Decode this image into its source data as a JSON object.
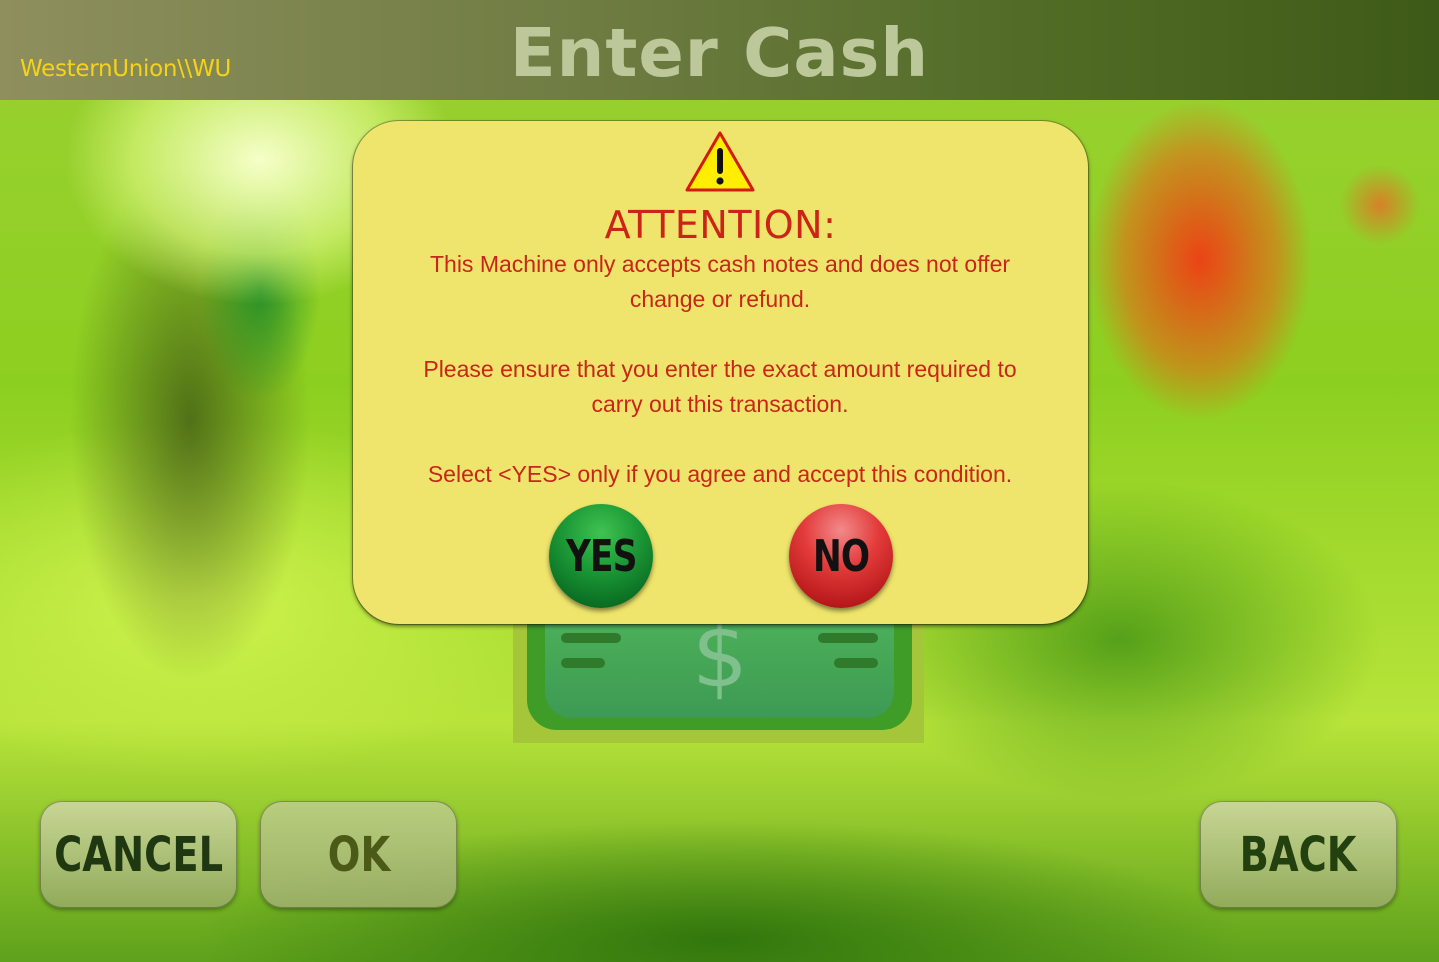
{
  "header": {
    "brand": "WesternUnion\\\\WU",
    "title": "Enter Cash"
  },
  "background_note": {
    "symbol": "$"
  },
  "dialog": {
    "icon": "warning-triangle-icon",
    "title": "ATTENTION:",
    "paragraphs": [
      "This Machine only accepts cash notes and does not offer change or refund.",
      "Please ensure that you enter the exact amount required to carry out this transaction.",
      "Select <YES> only if you agree and accept this condition."
    ],
    "yes_label": "YES",
    "no_label": "NO",
    "colors": {
      "background": "#efe56c",
      "text": "#c8261a",
      "yes": "#1d9a37",
      "no": "#d12a2a"
    }
  },
  "footer": {
    "cancel_label": "CANCEL",
    "ok_label": "OK",
    "back_label": "BACK"
  }
}
